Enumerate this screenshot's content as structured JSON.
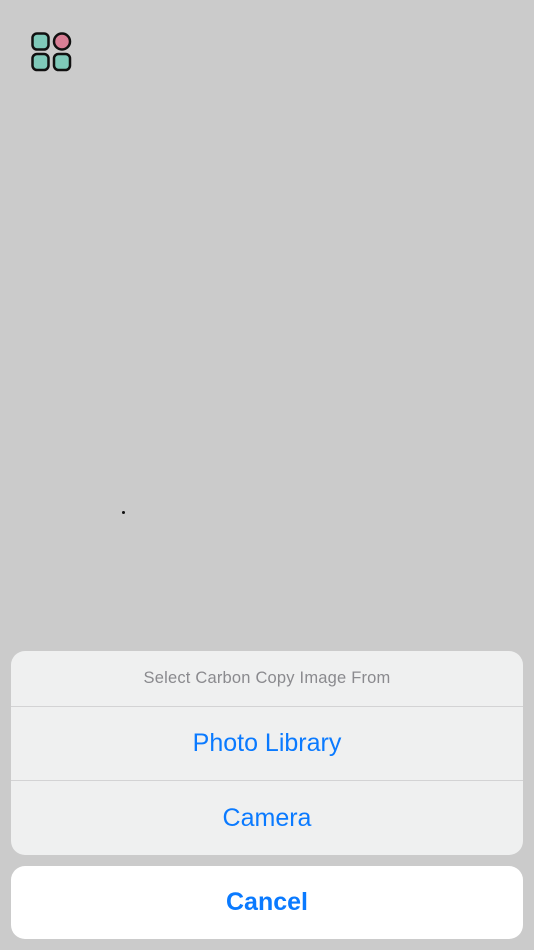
{
  "app": {
    "menu_icon": "app-grid-icon"
  },
  "action_sheet": {
    "title": "Select Carbon Copy Image From",
    "options": [
      {
        "label": "Photo Library"
      },
      {
        "label": "Camera"
      }
    ],
    "cancel_label": "Cancel"
  },
  "colors": {
    "background": "#cbcbcb",
    "sheet_background": "#eff0f0",
    "action_blue": "#0a7aff",
    "title_gray": "#8a8a8e",
    "icon_teal": "#7fc9b9",
    "icon_pink": "#d97e95",
    "icon_outline": "#111111"
  }
}
